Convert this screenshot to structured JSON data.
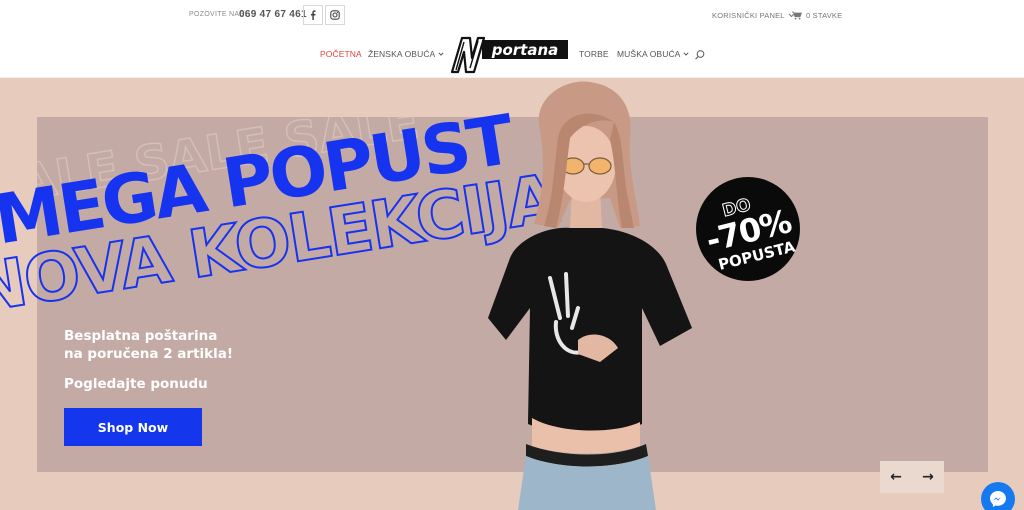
{
  "topbar": {
    "contact_label": "POZOVITE NAS:",
    "phone": "069 47 67 461",
    "social": [
      {
        "name": "facebook",
        "icon": "facebook-icon"
      },
      {
        "name": "instagram",
        "icon": "instagram-icon"
      }
    ],
    "account_label": "KORISNIČKI PANEL",
    "cart_label": "0 STAVKE"
  },
  "nav": {
    "items": [
      {
        "label": "POČETNA",
        "active": true,
        "dropdown": false
      },
      {
        "label": "ŽENSKA OBUĆA",
        "active": false,
        "dropdown": true
      },
      {
        "label": "TORBE",
        "active": false,
        "dropdown": false
      },
      {
        "label": "MUŠKA OBUĆA",
        "active": false,
        "dropdown": true
      }
    ],
    "logo_text": "portana",
    "logo_letter": "N",
    "search_icon": "search-icon"
  },
  "hero": {
    "headline_1": "MEGA POPUST",
    "headline_2": "NOVA KOLEKCIJA",
    "promo_line_1": "Besplatna poštarina",
    "promo_line_2": "na poručena 2 artikla!",
    "promo_line_3": "Pogledajte ponudu",
    "cta_label": "Shop Now",
    "badge_line_1": "DO",
    "badge_line_2": "-70%",
    "badge_line_3": "POPUSTA",
    "prev_arrow": "←",
    "next_arrow": "→"
  },
  "colors": {
    "accent_red": "#e0423b",
    "cta_blue": "#1437ee",
    "hero_bg": "#e7cbbd",
    "panel_bg": "#c4aaa4",
    "messenger_blue": "#1679f0"
  }
}
